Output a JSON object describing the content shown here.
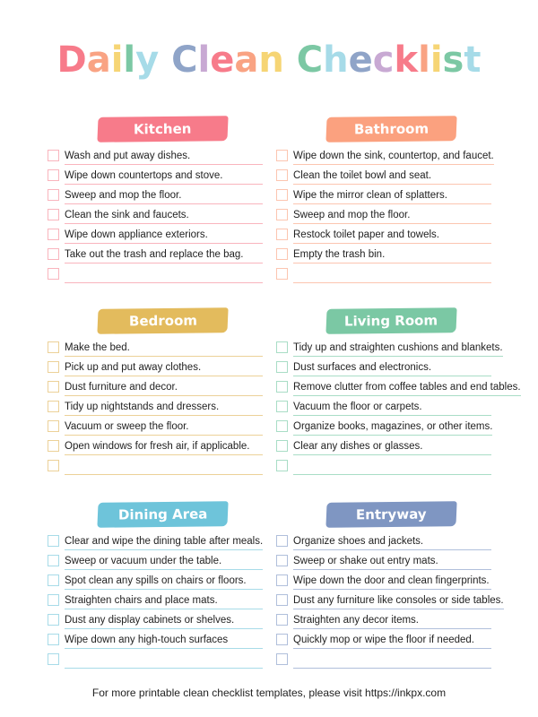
{
  "title": {
    "text": "Daily Clean Checklist",
    "letter_colors": [
      "#f77b8a",
      "#f9a383",
      "#f6d575",
      "#7cc8a4",
      "#a6dbe8",
      "#ffffff",
      "#8fa4c8",
      "#c8a9d3",
      "#f77b8a",
      "#f9a383",
      "#f6d575",
      "#ffffff",
      "#7cc8a4",
      "#a6dbe8",
      "#8fa4c8",
      "#c8a9d3",
      "#f77b8a",
      "#f9a383",
      "#f6d575",
      "#7cc8a4",
      "#a6dbe8"
    ]
  },
  "sections": [
    {
      "title": "Kitchen",
      "color": "#f77b8a",
      "line_color": "#f9b4bd",
      "items": [
        "Wash and put away dishes.",
        "Wipe down countertops and stove.",
        "Sweep and mop the floor.",
        "Clean the sink and faucets.",
        "Wipe down appliance exteriors.",
        "Take out the trash and replace the bag.",
        ""
      ]
    },
    {
      "title": "Bathroom",
      "color": "#fba17f",
      "line_color": "#fcc5b0",
      "items": [
        "Wipe down the sink, countertop, and faucet.",
        "Clean the toilet bowl and seat.",
        "Wipe the mirror clean of splatters.",
        "Sweep and mop the floor.",
        "Restock toilet paper and towels.",
        "Empty the trash bin.",
        ""
      ]
    },
    {
      "title": "Bedroom",
      "color": "#e3bb5d",
      "line_color": "#ecd198",
      "items": [
        "Make the bed.",
        "Pick up and put away clothes.",
        "Dust furniture and decor.",
        "Tidy up nightstands and dressers.",
        "Vacuum or sweep the floor.",
        "Open windows for fresh air, if applicable.",
        ""
      ]
    },
    {
      "title": "Living Room",
      "color": "#7bc8a4",
      "line_color": "#a9ddc6",
      "items": [
        "Tidy up and straighten cushions and blankets.",
        "Dust surfaces and electronics.",
        "Remove clutter from coffee tables and end tables.",
        "Vacuum the floor or carpets.",
        "Organize books, magazines, or other items.",
        "Clear any dishes or glasses.",
        ""
      ]
    },
    {
      "title": "Dining Area",
      "color": "#6ec4da",
      "line_color": "#a7dbe8",
      "items": [
        "Clear and wipe the dining table after meals.",
        "Sweep or vacuum under the table.",
        "Spot clean any spills on chairs or floors.",
        "Straighten chairs and place mats.",
        "Dust any display cabinets or shelves.",
        "Wipe down any high-touch surfaces",
        ""
      ]
    },
    {
      "title": "Entryway",
      "color": "#7f96c2",
      "line_color": "#b0bfdb",
      "items": [
        "Organize shoes and jackets.",
        "Sweep or shake out entry mats.",
        "Wipe down the door and clean fingerprints.",
        "Dust any furniture like consoles or side tables.",
        "Straighten any decor items.",
        "Quickly mop or wipe the floor if needed.",
        ""
      ]
    }
  ],
  "footer": "For more printable clean checklist templates, please visit https://inkpx.com"
}
